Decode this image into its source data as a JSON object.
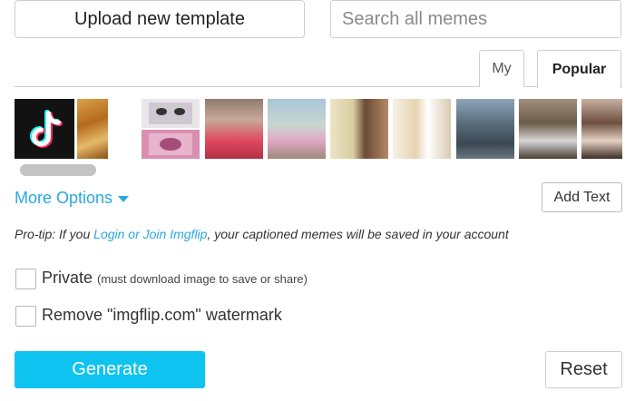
{
  "toolbar": {
    "upload_label": "Upload new template",
    "search_placeholder": "Search all memes"
  },
  "tabs": [
    {
      "label": "My",
      "active": false
    },
    {
      "label": "Popular",
      "active": true
    }
  ],
  "templates": [
    {
      "icon": "tiktok-logo-icon"
    },
    {
      "icon": "meme-thumbnail-icon"
    },
    {
      "icon": "meme-thumbnail-icon"
    },
    {
      "icon": "meme-thumbnail-icon"
    },
    {
      "icon": "meme-thumbnail-icon"
    },
    {
      "icon": "meme-thumbnail-icon"
    },
    {
      "icon": "meme-thumbnail-icon"
    },
    {
      "icon": "meme-thumbnail-icon"
    },
    {
      "icon": "meme-thumbnail-icon"
    },
    {
      "icon": "meme-thumbnail-icon"
    }
  ],
  "options": {
    "more_options_label": "More Options",
    "add_text_label": "Add Text"
  },
  "protip": {
    "prefix": "Pro-tip: If you ",
    "link": "Login or Join Imgflip",
    "suffix": ", your captioned memes will be saved in your account"
  },
  "checkboxes": {
    "private_label": "Private",
    "private_note": "(must download image to save or share)",
    "private_checked": false,
    "watermark_label": "Remove \"imgflip.com\" watermark",
    "watermark_checked": false
  },
  "actions": {
    "generate_label": "Generate",
    "reset_label": "Reset"
  },
  "colors": {
    "accent": "#0fc3f0",
    "link": "#29a9dc"
  }
}
